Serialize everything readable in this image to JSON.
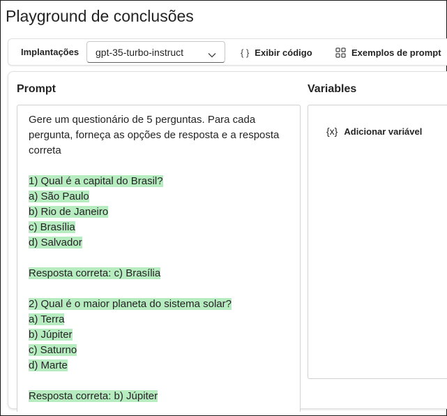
{
  "page": {
    "title": "Playground de conclusões"
  },
  "toolbar": {
    "deployments_label": "Implantações",
    "deployment_value": "gpt-35-turbo-instruct",
    "view_code_icon": "{ }",
    "view_code_label": "Exibir código",
    "examples_label": "Exemplos de prompt"
  },
  "prompt": {
    "title": "Prompt",
    "lines": [
      {
        "text": "Gere um questionário de 5 perguntas. Para cada pergunta, forneça as opções de resposta e a resposta correta",
        "highlight": false
      },
      {
        "text": "",
        "highlight": false
      },
      {
        "text": "1) Qual é a capital do Brasil?",
        "highlight": true
      },
      {
        "text": "a) São Paulo",
        "highlight": true
      },
      {
        "text": "b) Rio de Janeiro",
        "highlight": true
      },
      {
        "text": "c) Brasília",
        "highlight": true
      },
      {
        "text": "d) Salvador",
        "highlight": true
      },
      {
        "text": "",
        "highlight": false
      },
      {
        "text": "Resposta correta: c) Brasília",
        "highlight": true
      },
      {
        "text": "",
        "highlight": false
      },
      {
        "text": "2) Qual é o maior planeta do sistema solar?",
        "highlight": true
      },
      {
        "text": "a) Terra",
        "highlight": true
      },
      {
        "text": "b) Júpiter",
        "highlight": true
      },
      {
        "text": "c) Saturno",
        "highlight": true
      },
      {
        "text": "d) Marte",
        "highlight": true
      },
      {
        "text": "",
        "highlight": false
      },
      {
        "text": "Resposta correta: b) Júpiter",
        "highlight": true
      }
    ]
  },
  "variables": {
    "title": "Variables",
    "add_icon": "{x}",
    "add_label": "Adicionar variável"
  },
  "colors": {
    "highlight": "#b7ecc0",
    "text": "#242424",
    "border": "#d1d1d1"
  }
}
